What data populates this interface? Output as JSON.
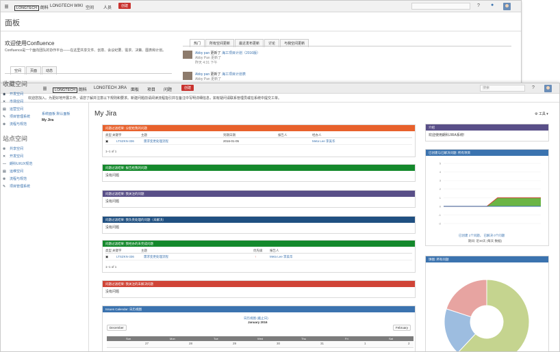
{
  "window1": {
    "nav": {
      "logo": "LONGTECH",
      "logo_suffix": "朗科",
      "app": "LONGTECH WIKI",
      "menu1": "空间",
      "menu2": "人员",
      "create": "创建"
    },
    "page_title": "面板",
    "welcome_title": "欢迎使用Confluence",
    "welcome_text": "Confluence是一个面向团队的协作平台——在这里共享文件、创意、会议纪要、需求、决策、图表和计划。",
    "space_tabs": [
      "空间",
      "页面",
      "动态"
    ],
    "space_tab_active": 0,
    "activity_tabs": [
      "热门",
      "所有空间更新",
      "最近发布更新",
      "讨论",
      "与我空间更新"
    ],
    "feed": [
      {
        "author": "Abby pan",
        "action": "更新了",
        "page": "海工项目计划（2016版）",
        "sub": "Abby Pan 更新了",
        "time": "昨天 4:31 下午"
      },
      {
        "author": "Abby pan",
        "action": "更新了",
        "page": "海工项目计划表",
        "sub": "Abby Pan 更新了",
        "time": ""
      }
    ]
  },
  "window2": {
    "nav": {
      "logo": "LONGTECH",
      "logo_suffix": "朗科",
      "app": "LONGTECH JIRA",
      "m1": "面板",
      "m2": "项目",
      "m3": "问题",
      "create": "创建",
      "search": "搜索"
    },
    "banner": "欢迎您加入。为更好地开展工作，请您了解并注意以下规则和要求。新建问题前请阅读流程指引并在备注中写明详细信息，如有疑问请联系管理员或在系统中提交工单。",
    "left_links": [
      "系统面板 默认面板",
      "My Jira"
    ],
    "dashboard_title": "My Jira",
    "tools": "工具",
    "gadgets": [
      {
        "title": "问题过滤结果: 分配给我的问题",
        "color": "#e8612c",
        "cols": [
          "类型",
          "关键字",
          "主题",
          "到期日期",
          "报告人",
          "经办人"
        ],
        "rows": [
          [
            "▣",
            "LTSZKN-336",
            "需求变更处理流程",
            "2016-01-05",
            "",
            "Meta Lee 李美华"
          ]
        ],
        "footer": "1–1 of 1"
      },
      {
        "title": "问题过滤结果: 报告给我的问题",
        "color": "#14892c",
        "body": "没有问题",
        "footer": ""
      },
      {
        "title": "问题过滤结果: 我关注的问题",
        "color": "#594f88",
        "body": "没有问题",
        "footer": ""
      },
      {
        "title": "问题过滤结果: 我负责处理的问题（未解决）",
        "color": "#205081",
        "body": "没有问题",
        "footer": ""
      },
      {
        "title": "问题过滤结果: 我经办的未完成问题",
        "color": "#14892c",
        "cols": [
          "类型",
          "关键字",
          "主题",
          "优先级",
          "报告人"
        ],
        "rows": [
          [
            "▣",
            "LTSZKN-336",
            "需求变更处理流程",
            "↑",
            "Meta Lee 李美华"
          ]
        ],
        "footer": "1–1 of 1"
      },
      {
        "title": "问题过滤结果: 我关注的未解决问题",
        "color": "#d04437",
        "body": "没有问题",
        "footer": ""
      }
    ],
    "calendar": {
      "header": "Issues Calendar: 日历视图",
      "color": "#3b73af",
      "subtitle": "日历视图 (截止日)",
      "month": "January 2016",
      "prev": "December",
      "next": "February",
      "days": [
        "Sun",
        "Mon",
        "Tue",
        "Wed",
        "Thu",
        "Fri",
        "Sat"
      ],
      "dates": [
        "27",
        "28",
        "29",
        "30",
        "31",
        "1",
        "2"
      ]
    },
    "intro": {
      "title": "介绍",
      "color": "#594f88",
      "text": "欢迎使用朗科JIRA系统!"
    },
    "line_chart": {
      "title": "已创建与已解决问题: 所有项目",
      "color": "#3b73af",
      "legend_a": "已创建 1个问题，",
      "legend_b": "已解决 0个问题",
      "footer": "期间: 近30天 (每天 数据)"
    },
    "pie": {
      "title": "饼图: 所有问题",
      "color": "#3b73af"
    }
  },
  "sidebar": {
    "fav_title": "收藏空间",
    "fav": [
      "开发空间",
      "市场空间",
      "运营空间",
      "项目管理系统",
      "流程与规范"
    ],
    "all_title": "站点空间",
    "all": [
      "共享空间",
      "开发空间",
      "朗科UI/UX规范",
      "运维空间",
      "流程与规范",
      "项目管理系统"
    ]
  },
  "chart_data": [
    {
      "type": "line",
      "title": "已创建与已解决问题",
      "series": [
        {
          "name": "已创建",
          "values": [
            0,
            0,
            0,
            0,
            0,
            1,
            1,
            1,
            1,
            1
          ]
        },
        {
          "name": "已解决",
          "values": [
            0,
            0,
            0,
            0,
            0,
            0,
            0,
            0,
            0,
            0
          ]
        }
      ],
      "ylim": [
        -2,
        5
      ]
    },
    {
      "type": "pie",
      "values": [
        62,
        18,
        20
      ],
      "colors": [
        "#c5d48f",
        "#9dbde0",
        "#e7a4a1"
      ]
    }
  ]
}
